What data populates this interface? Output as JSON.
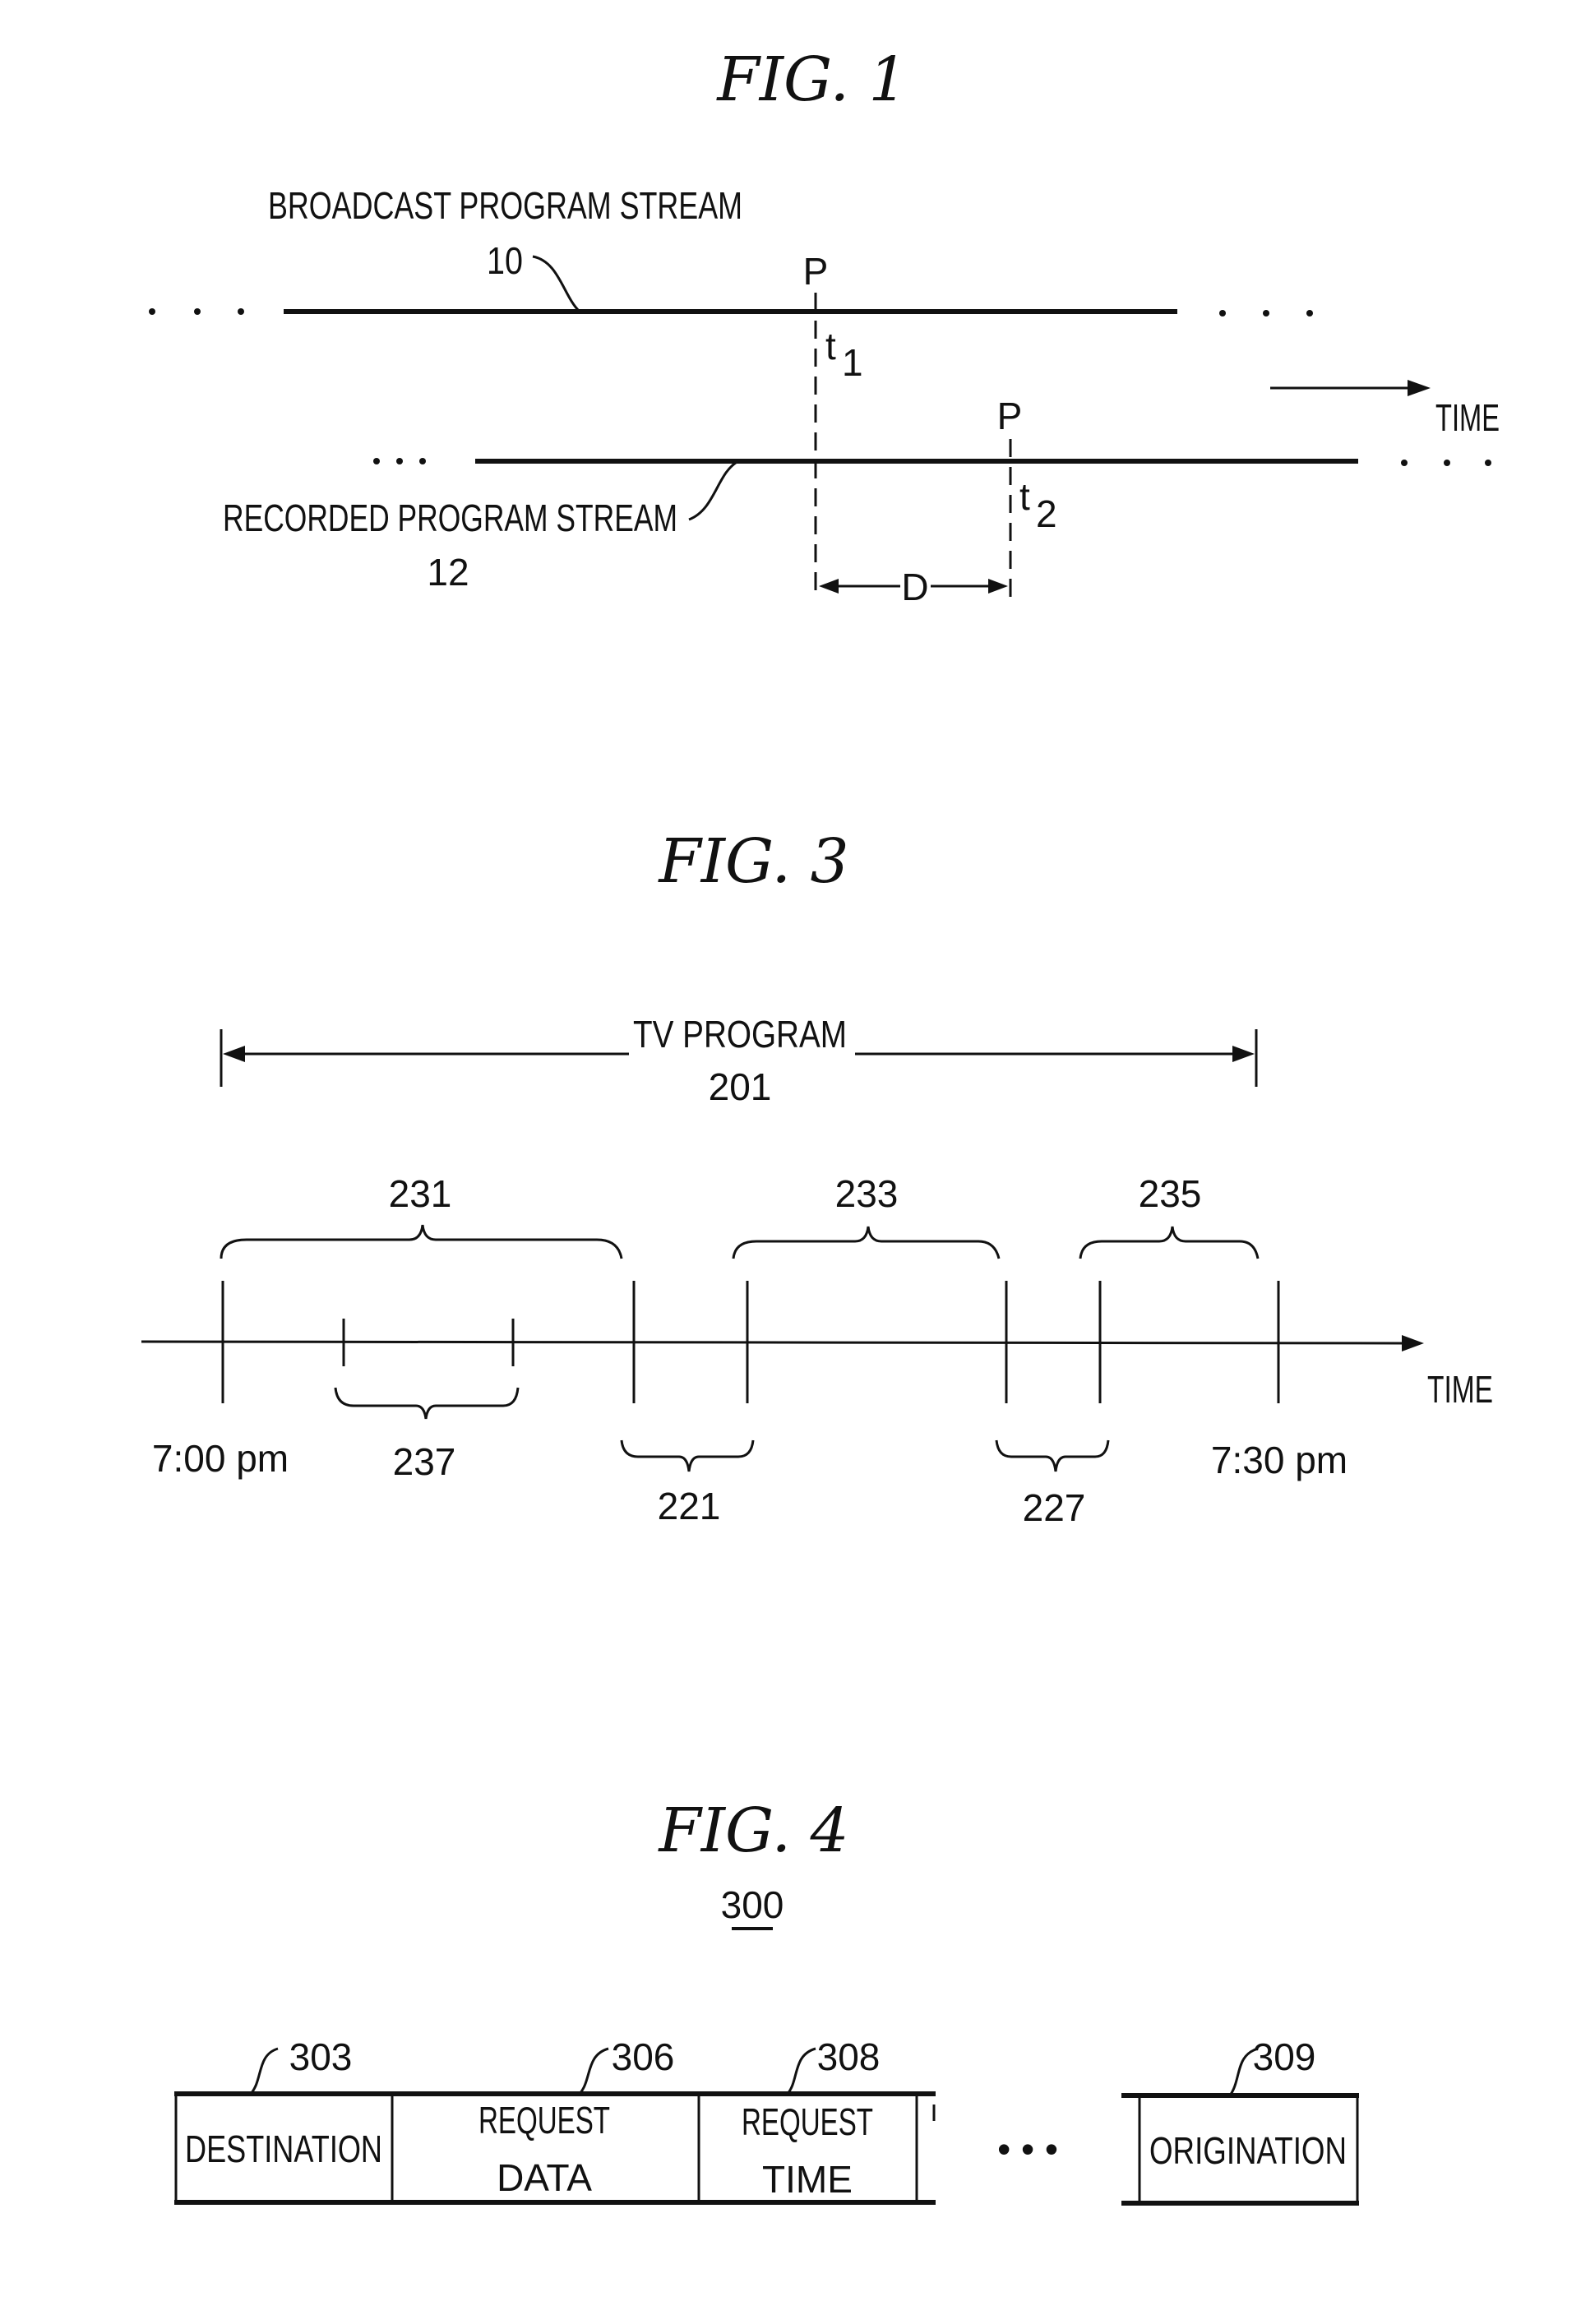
{
  "figures": {
    "fig1": {
      "title": "FIG. 1",
      "broadcast_label": "BROADCAST PROGRAM STREAM",
      "broadcast_ref": "10",
      "recorded_label": "RECORDED PROGRAM STREAM",
      "recorded_ref": "12",
      "point_label_1": "P",
      "point_label_2": "P",
      "t1": "t",
      "t1_sub": "1",
      "t2": "t",
      "t2_sub": "2",
      "delay_label": "D",
      "time_label": "TIME"
    },
    "fig3": {
      "title": "FIG. 3",
      "program_label": "TV PROGRAM",
      "program_ref": "201",
      "segments": [
        {
          "ref": "231"
        },
        {
          "ref": "233"
        },
        {
          "ref": "235"
        }
      ],
      "sub_segment_ref": "237",
      "breaks": [
        {
          "ref": "221"
        },
        {
          "ref": "227"
        }
      ],
      "start_time": "7:00 pm",
      "end_time": "7:30 pm",
      "time_label": "TIME"
    },
    "fig4": {
      "title": "FIG. 4",
      "ref": "300",
      "fields": [
        {
          "ref": "303",
          "line1": "DESTINATION",
          "line2": ""
        },
        {
          "ref": "306",
          "line1": "REQUEST",
          "line2": "DATA"
        },
        {
          "ref": "308",
          "line1": "REQUEST",
          "line2": "TIME"
        },
        {
          "ref": "309",
          "line1": "ORIGINATION",
          "line2": ""
        }
      ],
      "ellipsis": "• • •"
    }
  }
}
